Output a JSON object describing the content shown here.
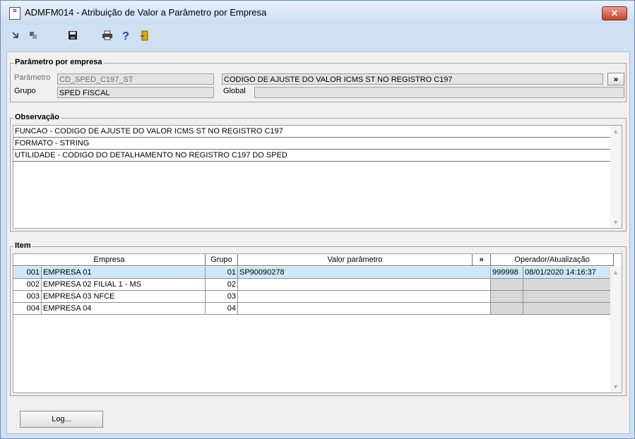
{
  "window": {
    "title": "ADMFM014 - Atribuição de Valor a Parâmetro por Empresa",
    "close_label": "✕"
  },
  "toolbar": {
    "icons": [
      "back-icon",
      "forward-icon",
      "save-icon",
      "print-icon",
      "help-icon",
      "exit-icon"
    ],
    "help_label": "?"
  },
  "parametro": {
    "legend": "Parâmetro por empresa",
    "parametro_label": "Parâmetro",
    "parametro_code": "CD_SPED_C197_ST",
    "parametro_desc": "CODIGO DE AJUSTE DO VALOR ICMS ST NO REGISTRO C197",
    "expand_label": "»",
    "grupo_label": "Grupo",
    "grupo_value": "SPED FISCAL",
    "global_label": "Global",
    "global_value": ""
  },
  "observacao": {
    "legend": "Observação",
    "lines": [
      "FUNCAO - CODIGO DE AJUSTE DO VALOR ICMS ST NO REGISTRO C197",
      "FORMATO - STRING",
      "UTILIDADE - CODIGO DO DETALHAMENTO NO REGISTRO C197 DO SPED"
    ]
  },
  "item": {
    "legend": "Item",
    "headers": {
      "empresa": "Empresa",
      "grupo": "Grupo",
      "valor": "Valor parâmetro",
      "expand": "»",
      "operador": "Operador/Atualização"
    },
    "rows": [
      {
        "codigo": "001",
        "empresa": "EMPRESA 01",
        "grupo": "01",
        "valor": "SP90090278",
        "operador": "999998",
        "atualizacao": "08/01/2020 14:16:37"
      },
      {
        "codigo": "002",
        "empresa": "EMPRESA 02 FILIAL 1 - MS",
        "grupo": "02",
        "valor": "",
        "operador": "",
        "atualizacao": ""
      },
      {
        "codigo": "003",
        "empresa": "EMPRESA 03 NFCE",
        "grupo": "03",
        "valor": "",
        "operador": "",
        "atualizacao": ""
      },
      {
        "codigo": "004",
        "empresa": "EMPRESA 04",
        "grupo": "04",
        "valor": "",
        "operador": "",
        "atualizacao": ""
      }
    ]
  },
  "footer": {
    "log_label": "Log..."
  },
  "colors": {
    "titlebar": "#c9dcf1",
    "selection": "#cde8f6",
    "close": "#c4422c"
  }
}
